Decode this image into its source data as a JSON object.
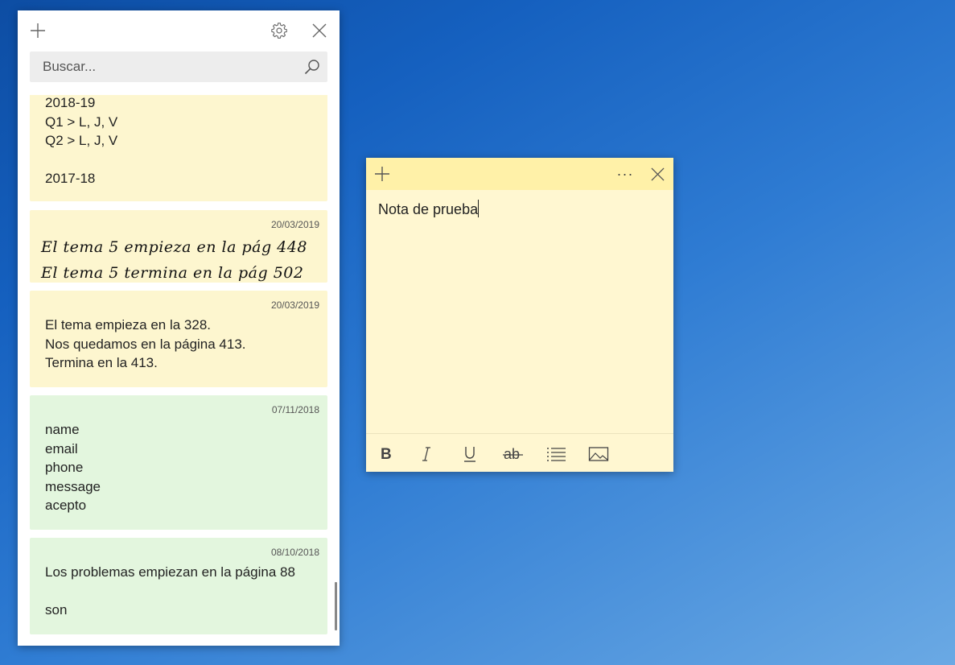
{
  "list_window": {
    "search": {
      "placeholder": "Buscar..."
    },
    "notes": [
      {
        "color": "#fdf6cf",
        "date": "",
        "text": "2018-19\nQ1 > L, J, V\nQ2 > L, J, V\n\n2017-18"
      },
      {
        "color": "#fdf6cf",
        "date": "20/03/2019",
        "handwriting": "El tema 5 empieza en la pág 448\nEl tema 5 termina en la pág 502"
      },
      {
        "color": "#fdf6cf",
        "date": "20/03/2019",
        "text": "El tema empieza en la 328.\nNos quedamos en la página 413.\nTermina en la 413."
      },
      {
        "color": "#e3f6de",
        "date": "07/11/2018",
        "text": "name\nemail\nphone\nmessage\nacepto"
      },
      {
        "color": "#e3f6de",
        "date": "08/10/2018",
        "text": "Los problemas empiezan en la página 88\n\nson"
      }
    ]
  },
  "note_window": {
    "text": "Nota de prueba",
    "more_label": "···",
    "toolbar": [
      "bold-icon",
      "italic-icon",
      "underline-icon",
      "strikethrough-icon",
      "bullet-list-icon",
      "image-icon"
    ]
  },
  "colors": {
    "note_yellow": "#fdf6cf",
    "note_green": "#e3f6de",
    "note_header_yellow": "#fff1a8"
  }
}
